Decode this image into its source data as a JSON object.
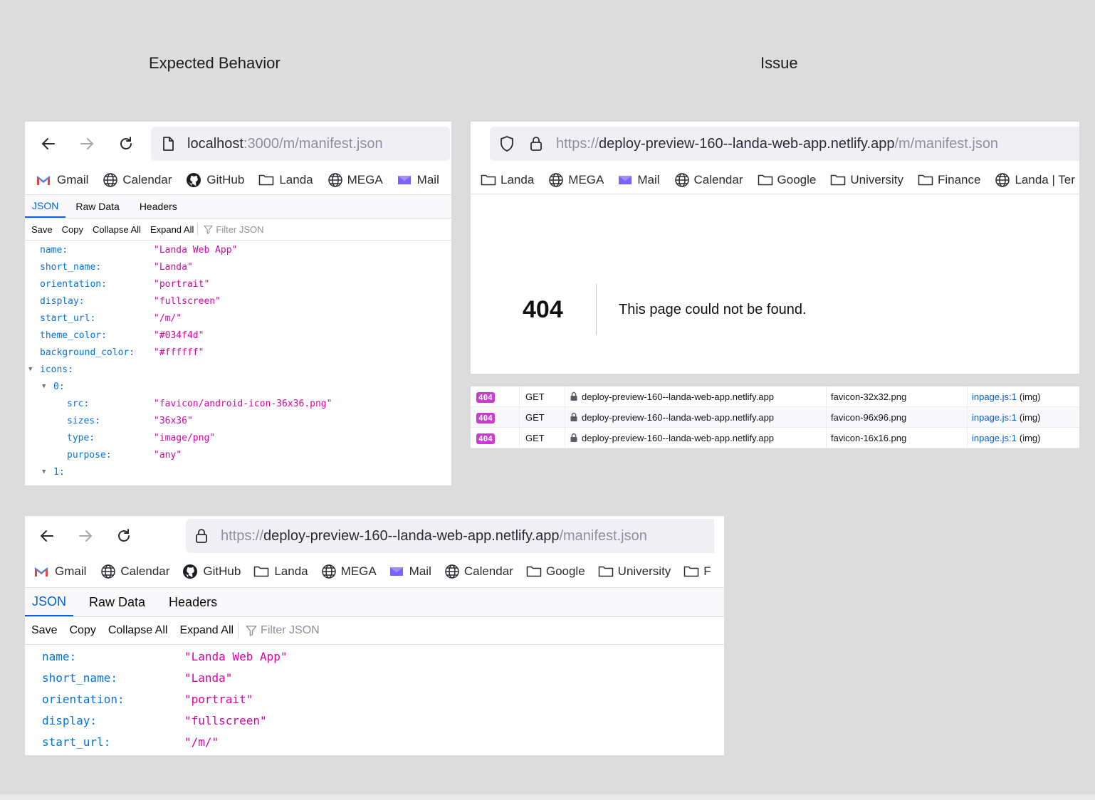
{
  "headings": {
    "expected": "Expected Behavior",
    "issue": "Issue"
  },
  "panel1": {
    "url_host": "localhost",
    "url_path": ":3000/m/manifest.json",
    "bookmarks": [
      {
        "icon": "gmail-icon",
        "label": "Gmail"
      },
      {
        "icon": "globe-icon",
        "label": "Calendar"
      },
      {
        "icon": "github-icon",
        "label": "GitHub"
      },
      {
        "icon": "folder-icon",
        "label": "Landa"
      },
      {
        "icon": "globe-icon",
        "label": "MEGA"
      },
      {
        "icon": "mail-icon",
        "label": "Mail"
      }
    ],
    "tabs": [
      "JSON",
      "Raw Data",
      "Headers"
    ],
    "toolbar": {
      "save": "Save",
      "copy": "Copy",
      "collapse": "Collapse All",
      "expand": "Expand All",
      "filter": "Filter JSON"
    },
    "json": [
      {
        "key": "name:",
        "value": "\"Landa Web App\""
      },
      {
        "key": "short_name:",
        "value": "\"Landa\""
      },
      {
        "key": "orientation:",
        "value": "\"portrait\""
      },
      {
        "key": "display:",
        "value": "\"fullscreen\""
      },
      {
        "key": "start_url:",
        "value": "\"/m/\""
      },
      {
        "key": "theme_color:",
        "value": "\"#034f4d\""
      },
      {
        "key": "background_color:",
        "value": "\"#ffffff\""
      },
      {
        "key": "icons:",
        "value": ""
      },
      {
        "key": "0:",
        "value": ""
      },
      {
        "key": "src:",
        "value": "\"favicon/android-icon-36x36.png\""
      },
      {
        "key": "sizes:",
        "value": "\"36x36\""
      },
      {
        "key": "type:",
        "value": "\"image/png\""
      },
      {
        "key": "purpose:",
        "value": "\"any\""
      },
      {
        "key": "1:",
        "value": ""
      }
    ]
  },
  "panel2": {
    "url_scheme": "https://",
    "url_host": "deploy-preview-160--landa-web-app.netlify.app",
    "url_path": "/m/manifest.json",
    "bookmarks": [
      {
        "icon": "folder-icon",
        "label": "Landa"
      },
      {
        "icon": "globe-icon",
        "label": "MEGA"
      },
      {
        "icon": "mail-icon",
        "label": "Mail"
      },
      {
        "icon": "globe-icon",
        "label": "Calendar"
      },
      {
        "icon": "folder-icon",
        "label": "Google"
      },
      {
        "icon": "folder-icon",
        "label": "University"
      },
      {
        "icon": "folder-icon",
        "label": "Finance"
      },
      {
        "icon": "globe-icon",
        "label": "Landa | Ter"
      }
    ],
    "error_code": "404",
    "error_message": "This page could not be found."
  },
  "network": [
    {
      "status": "404",
      "method": "GET",
      "domain": "deploy-preview-160--landa-web-app.netlify.app",
      "file": "favicon-32x32.png",
      "initiator": "inpage.js:1",
      "type": "(img)"
    },
    {
      "status": "404",
      "method": "GET",
      "domain": "deploy-preview-160--landa-web-app.netlify.app",
      "file": "favicon-96x96.png",
      "initiator": "inpage.js:1",
      "type": "(img)"
    },
    {
      "status": "404",
      "method": "GET",
      "domain": "deploy-preview-160--landa-web-app.netlify.app",
      "file": "favicon-16x16.png",
      "initiator": "inpage.js:1",
      "type": "(img)"
    }
  ],
  "panel3": {
    "url_scheme": "https://",
    "url_host": "deploy-preview-160--landa-web-app.netlify.app",
    "url_path": "/manifest.json",
    "bookmarks": [
      {
        "icon": "gmail-icon",
        "label": "Gmail"
      },
      {
        "icon": "globe-icon",
        "label": "Calendar"
      },
      {
        "icon": "github-icon",
        "label": "GitHub"
      },
      {
        "icon": "folder-icon",
        "label": "Landa"
      },
      {
        "icon": "globe-icon",
        "label": "MEGA"
      },
      {
        "icon": "mail-icon",
        "label": "Mail"
      },
      {
        "icon": "globe-icon",
        "label": "Calendar"
      },
      {
        "icon": "folder-icon",
        "label": "Google"
      },
      {
        "icon": "folder-icon",
        "label": "University"
      },
      {
        "icon": "folder-icon",
        "label": "F"
      }
    ],
    "tabs": [
      "JSON",
      "Raw Data",
      "Headers"
    ],
    "toolbar": {
      "save": "Save",
      "copy": "Copy",
      "collapse": "Collapse All",
      "expand": "Expand All",
      "filter": "Filter JSON"
    },
    "json": [
      {
        "key": "name:",
        "value": "\"Landa Web App\""
      },
      {
        "key": "short_name:",
        "value": "\"Landa\""
      },
      {
        "key": "orientation:",
        "value": "\"portrait\""
      },
      {
        "key": "display:",
        "value": "\"fullscreen\""
      },
      {
        "key": "start_url:",
        "value": "\"/m/\""
      }
    ]
  }
}
